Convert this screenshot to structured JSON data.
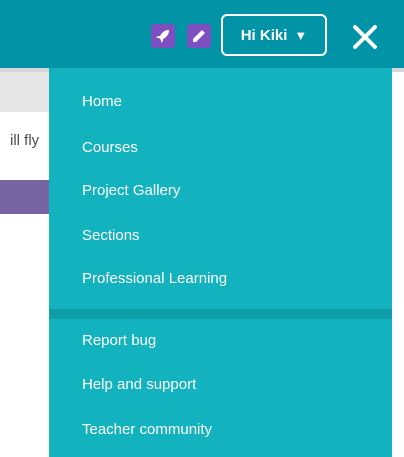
{
  "header": {
    "user_button_label": "Hi Kiki",
    "caret": "▼",
    "icons": [
      "rocket-icon",
      "pencil-icon",
      "close-icon"
    ]
  },
  "background": {
    "partial_text": "ill fly"
  },
  "menu": {
    "primary_items": [
      {
        "label": "Home"
      },
      {
        "label": "Courses"
      },
      {
        "label": "Project Gallery"
      },
      {
        "label": "Sections"
      },
      {
        "label": "Professional Learning"
      }
    ],
    "secondary_items": [
      {
        "label": "Report bug"
      },
      {
        "label": "Help and support"
      },
      {
        "label": "Teacher community"
      }
    ]
  },
  "colors": {
    "header": "#0094a6",
    "menu": "#12b3bf",
    "icon_purple": "#7d4fc0"
  }
}
